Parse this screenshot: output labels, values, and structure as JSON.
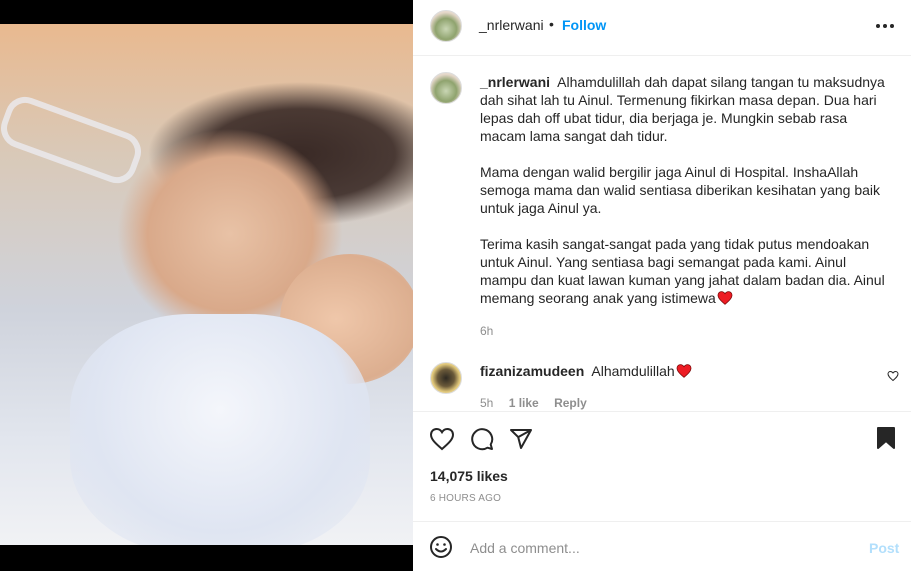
{
  "post": {
    "author": "_nrlerwani",
    "follow_label": "Follow",
    "separator": "•"
  },
  "caption": {
    "username": "_nrlerwani",
    "paragraphs": [
      "Alhamdulillah dah dapat silang tangan tu maksudnya dah sihat lah tu Ainul. Termenung fikirkan masa depan. Dua hari lepas dah off ubat tidur, dia berjaga je. Mungkin sebab rasa macam lama sangat dah tidur.",
      "Mama dengan walid bergilir jaga Ainul di Hospital. InshaAllah semoga mama dan walid sentiasa diberikan kesihatan yang baik untuk jaga Ainul ya.",
      "Terima kasih sangat-sangat pada yang tidak putus mendoakan untuk Ainul. Yang sentiasa bagi semangat pada kami. Ainul mampu dan kuat lawan kuman yang jahat dalam badan dia. Ainul memang seorang anak yang istimewa"
    ],
    "time": "6h"
  },
  "comments": [
    {
      "username": "fizanizamudeen",
      "text": "Alhamdulillah",
      "time": "5h",
      "likes": "1 like",
      "reply_label": "Reply"
    }
  ],
  "actions": {
    "likes": "14,075 likes",
    "timestamp": "6 HOURS AGO"
  },
  "composer": {
    "placeholder": "Add a comment...",
    "post_label": "Post"
  },
  "icons": {
    "more": "more-options-icon",
    "heart": "heart-icon",
    "comment": "comment-icon",
    "share": "share-icon",
    "save": "bookmark-icon",
    "emoji": "emoji-icon"
  },
  "colors": {
    "accent": "#0095f6",
    "post_disabled": "#b2dffc",
    "heart_red": "#ed4956",
    "secondary_text": "#8e8e8e"
  }
}
